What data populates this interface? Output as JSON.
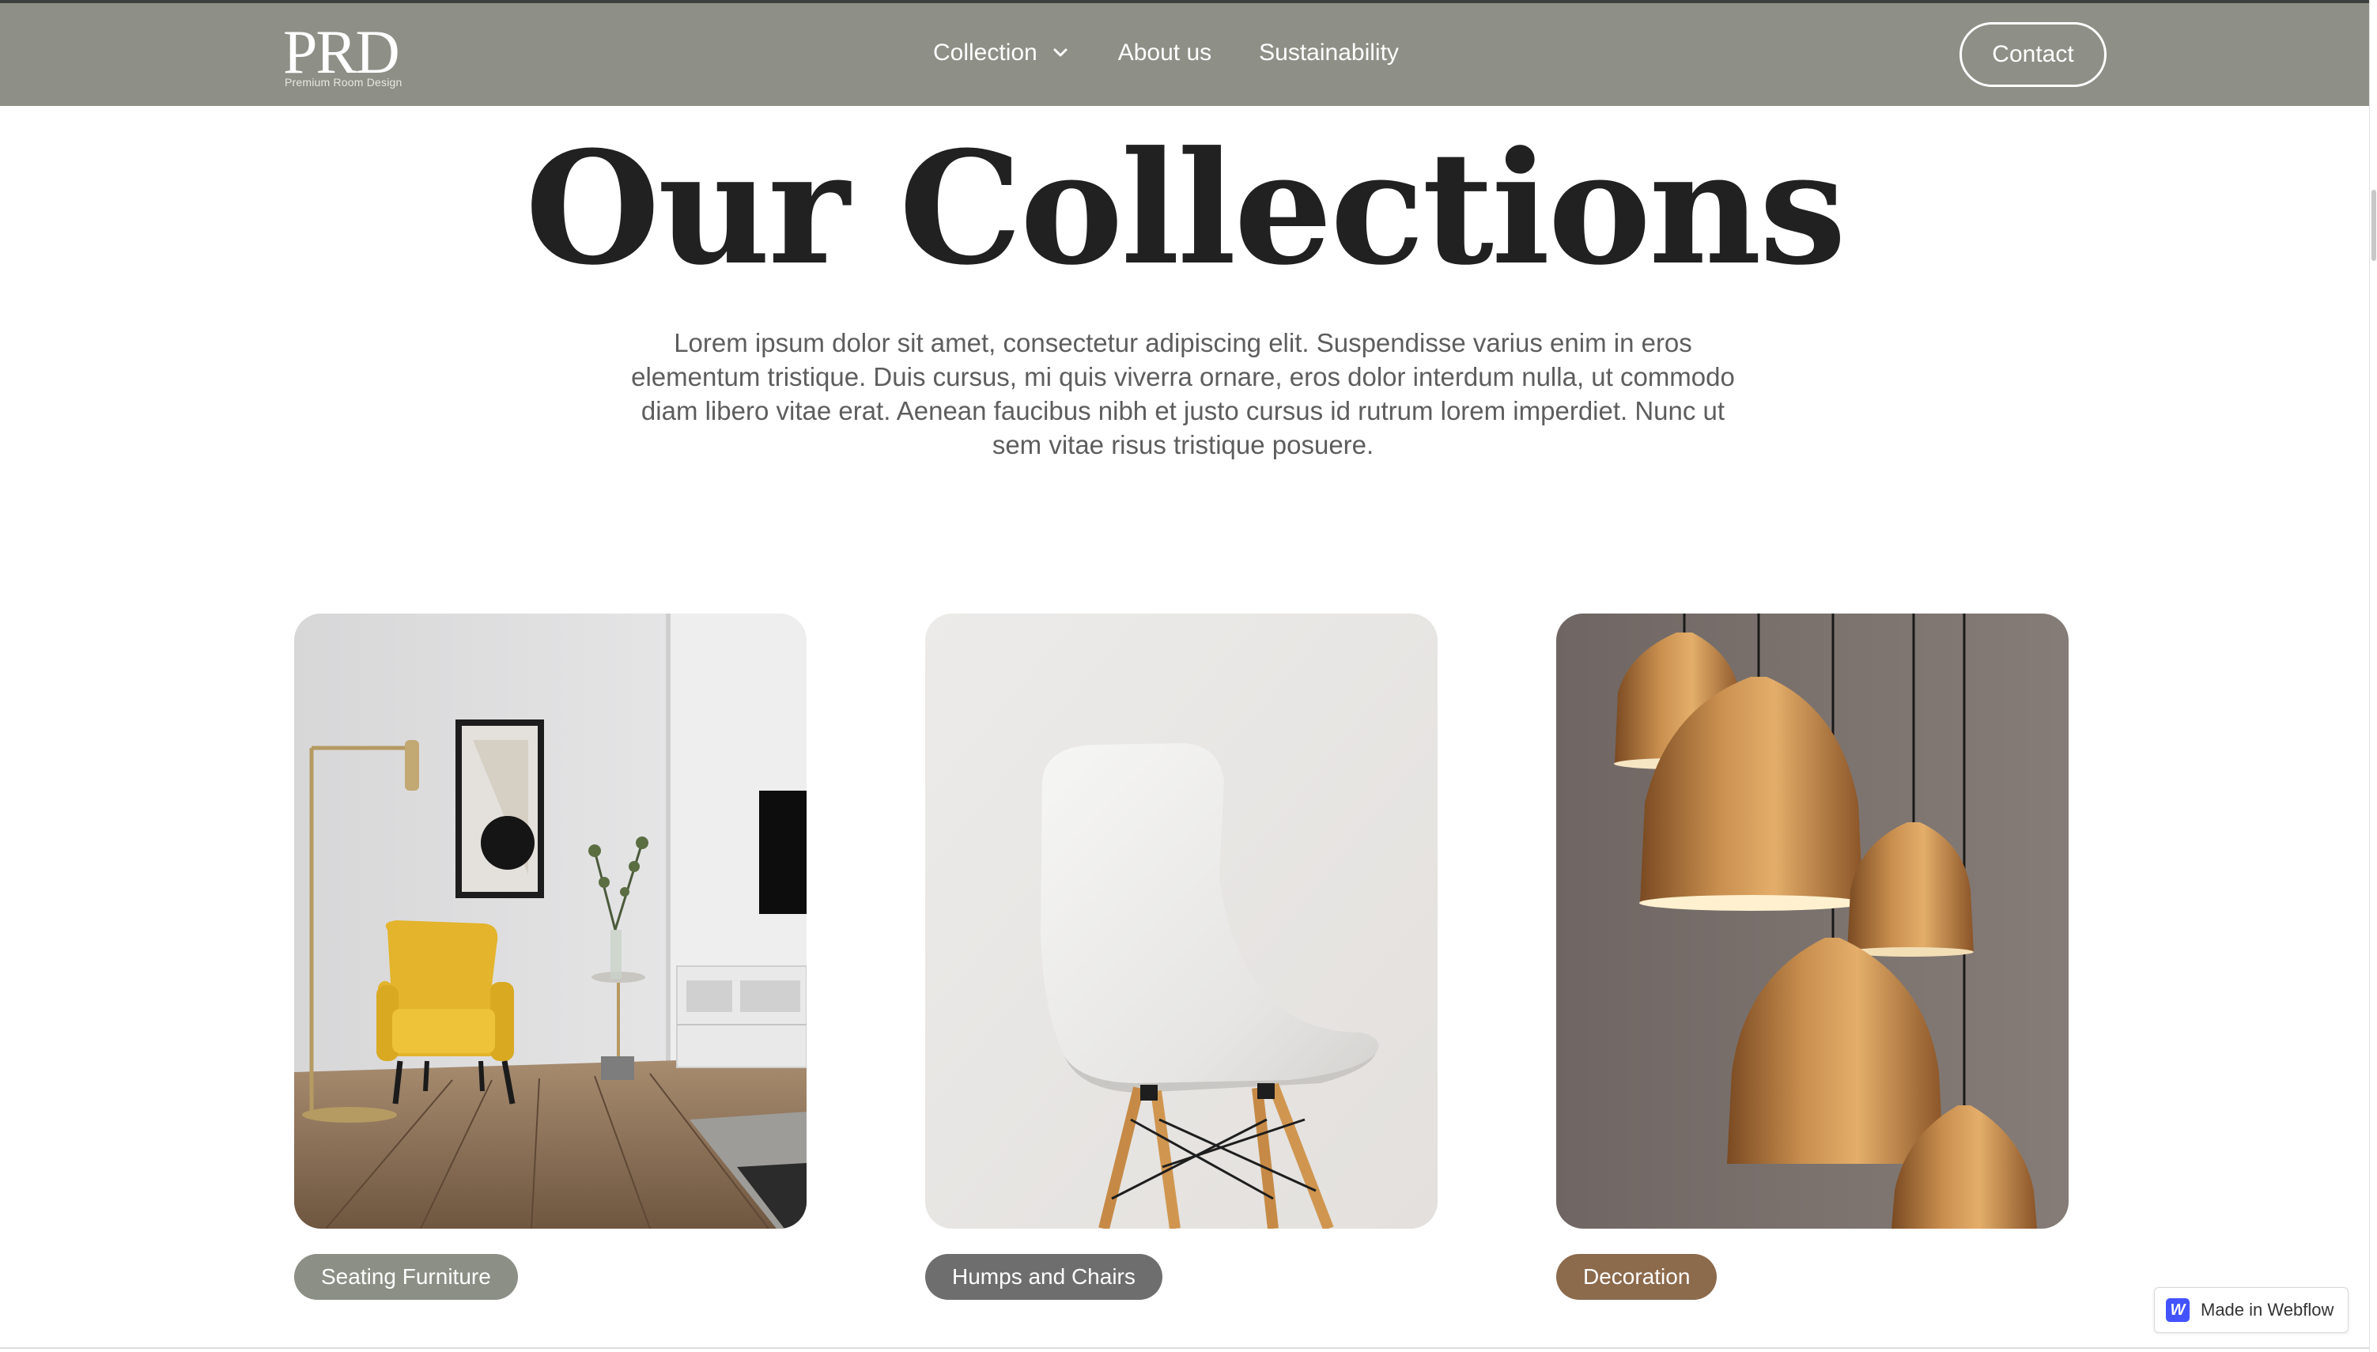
{
  "colors": {
    "nav_background": "#8e8f86",
    "tag_seating": "#8c8f85",
    "tag_humps": "#6e6e6e",
    "tag_decor": "#8c6a4c",
    "webflow_blue": "#4353ff"
  },
  "brand": {
    "logo": "PRD",
    "tagline": "Premium Room Design"
  },
  "nav": {
    "items": [
      {
        "label": "Collection",
        "icon": "chevron-down-icon"
      },
      {
        "label": "About us"
      },
      {
        "label": "Sustainability"
      }
    ],
    "contact_label": "Contact"
  },
  "hero": {
    "title": "Our Collections",
    "text": "Lorem ipsum dolor sit amet, consectetur adipiscing elit. Suspendisse varius enim in eros elementum tristique. Duis cursus, mi quis viverra ornare, eros dolor interdum nulla, ut commodo diam libero vitae erat. Aenean faucibus nibh et justo cursus id rutrum lorem imperdiet. Nunc ut sem vitae risus tristique posuere."
  },
  "collections": [
    {
      "label": "Seating Furniture",
      "image": "living-room-yellow-armchair"
    },
    {
      "label": "Humps and Chairs",
      "image": "white-shell-chair"
    },
    {
      "label": "Decoration",
      "image": "copper-pendant-lamps"
    }
  ],
  "badge": {
    "icon": "W",
    "label": "Made in Webflow"
  }
}
